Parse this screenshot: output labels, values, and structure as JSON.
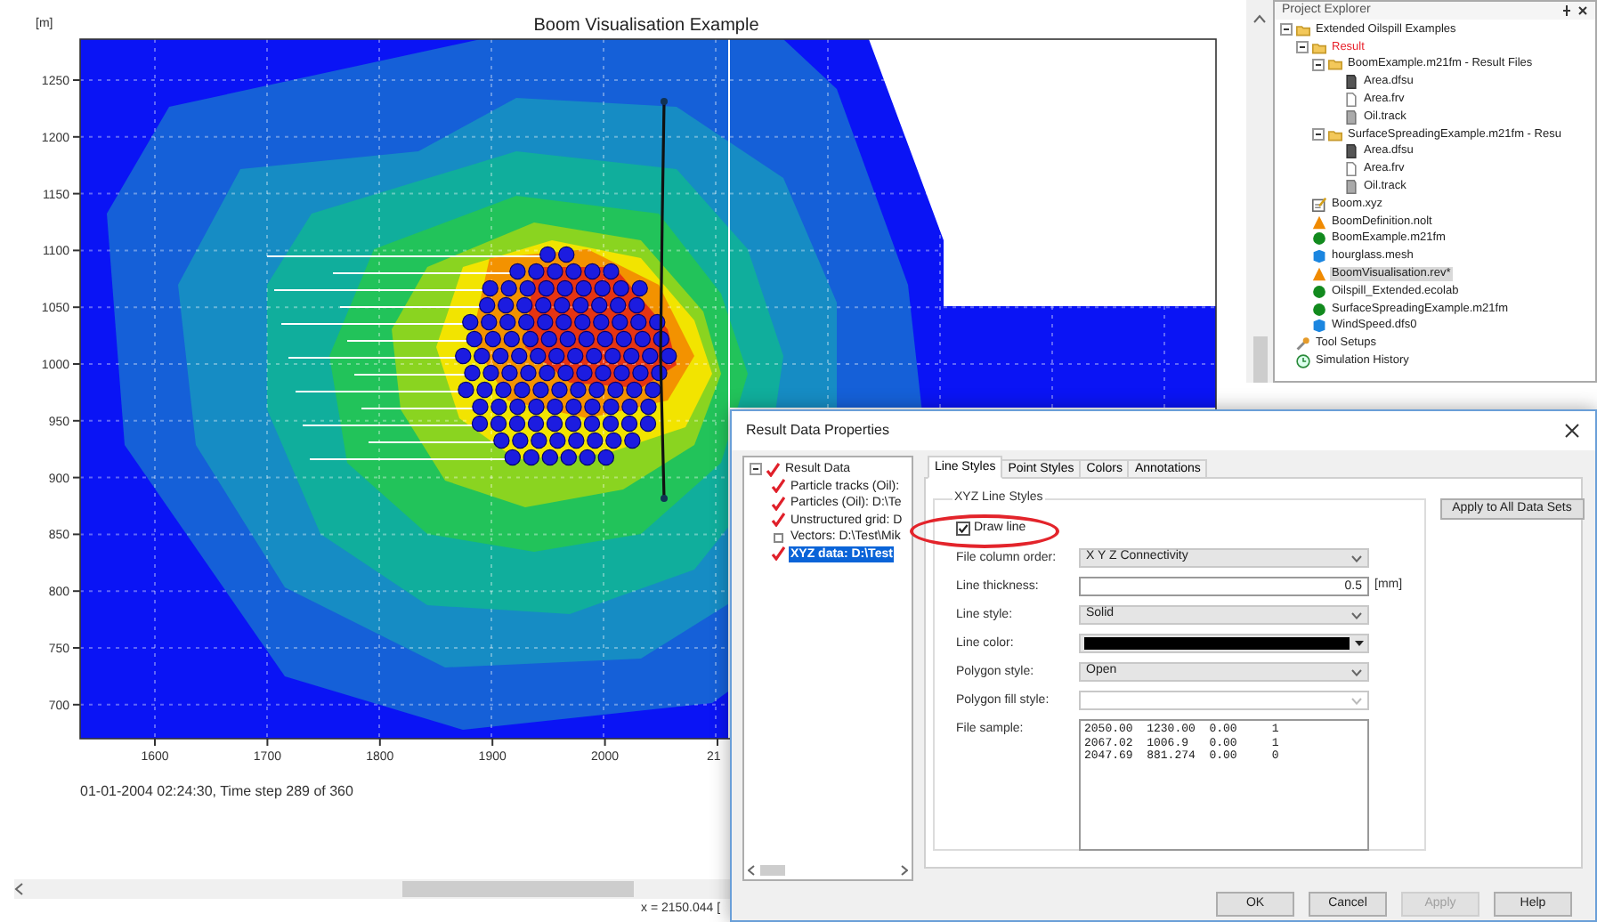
{
  "plot": {
    "title": "Boom Visualisation Example",
    "y_unit": "[m]",
    "yticks": [
      "1250",
      "1200",
      "1150",
      "1100",
      "1050",
      "1000",
      "950",
      "900",
      "850",
      "800",
      "750",
      "700"
    ],
    "xticks": [
      "1600",
      "1700",
      "1800",
      "1900",
      "2000",
      "21"
    ],
    "time_label": "01-01-2004 02:24:30, Time step 289 of 360",
    "status": "x = 2150.044 ["
  },
  "project_explorer": {
    "title": "Project Explorer",
    "items": [
      {
        "label": "Extended Oilspill Examples",
        "kind": "folder",
        "expanded": true,
        "active": false,
        "selected": false,
        "children": [
          {
            "label": "Result",
            "kind": "folder",
            "expanded": true,
            "active": true,
            "selected": false,
            "children": [
              {
                "label": "BoomExample.m21fm - Result Files",
                "kind": "folder",
                "expanded": true,
                "active": false,
                "selected": false,
                "children": [
                  {
                    "label": "Area.dfsu",
                    "kind": "grid",
                    "active": false,
                    "selected": false
                  },
                  {
                    "label": "Area.frv",
                    "kind": "document",
                    "active": false,
                    "selected": false
                  },
                  {
                    "label": "Oil.track",
                    "kind": "track",
                    "active": false,
                    "selected": false
                  }
                ]
              },
              {
                "label": "SurfaceSpreadingExample.m21fm - Resu",
                "kind": "folder",
                "expanded": true,
                "active": false,
                "selected": false,
                "children": [
                  {
                    "label": "Area.dfsu",
                    "kind": "grid",
                    "active": false,
                    "selected": false
                  },
                  {
                    "label": "Area.frv",
                    "kind": "document",
                    "active": false,
                    "selected": false
                  },
                  {
                    "label": "Oil.track",
                    "kind": "track",
                    "active": false,
                    "selected": false
                  }
                ]
              }
            ]
          },
          {
            "label": "Boom.xyz",
            "kind": "xyz",
            "active": false,
            "selected": false
          },
          {
            "label": "BoomDefinition.nolt",
            "kind": "triangle",
            "active": false,
            "selected": false
          },
          {
            "label": "BoomExample.m21fm",
            "kind": "circle",
            "active": false,
            "selected": false
          },
          {
            "label": "hourglass.mesh",
            "kind": "square",
            "active": false,
            "selected": false
          },
          {
            "label": "BoomVisualisation.rev*",
            "kind": "triangle",
            "active": false,
            "selected": true
          },
          {
            "label": "Oilspill_Extended.ecolab",
            "kind": "circle",
            "active": false,
            "selected": false
          },
          {
            "label": "SurfaceSpreadingExample.m21fm",
            "kind": "circle",
            "active": false,
            "selected": false
          },
          {
            "label": "WindSpeed.dfs0",
            "kind": "square",
            "active": false,
            "selected": false
          }
        ]
      },
      {
        "label": "Tool Setups",
        "kind": "tools",
        "active": false,
        "selected": false
      },
      {
        "label": "Simulation History",
        "kind": "history",
        "active": false,
        "selected": false
      }
    ]
  },
  "dialog": {
    "title": "Result Data Properties",
    "tree": [
      {
        "label": "Result Data",
        "checked": true,
        "selected": false,
        "expanded": true,
        "children": [
          {
            "label": "Particle tracks (Oil):",
            "checked": true,
            "selected": false
          },
          {
            "label": "Particles (Oil): D:\\Te",
            "checked": true,
            "selected": false
          },
          {
            "label": "Unstructured grid: D",
            "checked": true,
            "selected": false
          },
          {
            "label": "Vectors: D:\\Test\\Mik",
            "checked": false,
            "selected": false
          },
          {
            "label": "XYZ data: D:\\Test",
            "checked": true,
            "selected": true
          }
        ]
      }
    ],
    "tabs": [
      {
        "label": "Line Styles",
        "selected": true
      },
      {
        "label": "Point Styles",
        "selected": false
      },
      {
        "label": "Colors",
        "selected": false
      },
      {
        "label": "Annotations",
        "selected": false
      }
    ],
    "group_title": "XYZ Line Styles",
    "draw_line": {
      "label": "Draw line",
      "checked": true
    },
    "apply_all": "Apply to All Data Sets",
    "fields": [
      {
        "label": "File column order:",
        "kind": "dropdown",
        "value": "X Y Z Connectivity",
        "disabled": false
      },
      {
        "label": "Line thickness:",
        "kind": "number",
        "value": "0.5",
        "unit": "[mm]"
      },
      {
        "label": "Line style:",
        "kind": "dropdown",
        "value": "Solid",
        "disabled": false
      },
      {
        "label": "Line color:",
        "kind": "color",
        "color": "#000000"
      },
      {
        "label": "Polygon style:",
        "kind": "dropdown",
        "value": "Open",
        "disabled": false
      },
      {
        "label": "Polygon fill style:",
        "kind": "dropdown",
        "disabled": true
      },
      {
        "label": "File sample:",
        "kind": "text",
        "lines": [
          "2050.00  1230.00  0.00     1",
          "2067.02  1006.9   0.00     1",
          "2047.69  881.274  0.00     0"
        ]
      }
    ],
    "buttons": [
      {
        "label": "OK",
        "disabled": false
      },
      {
        "label": "Cancel",
        "disabled": false
      },
      {
        "label": "Apply",
        "disabled": true
      },
      {
        "label": "Help",
        "disabled": false
      }
    ]
  }
}
